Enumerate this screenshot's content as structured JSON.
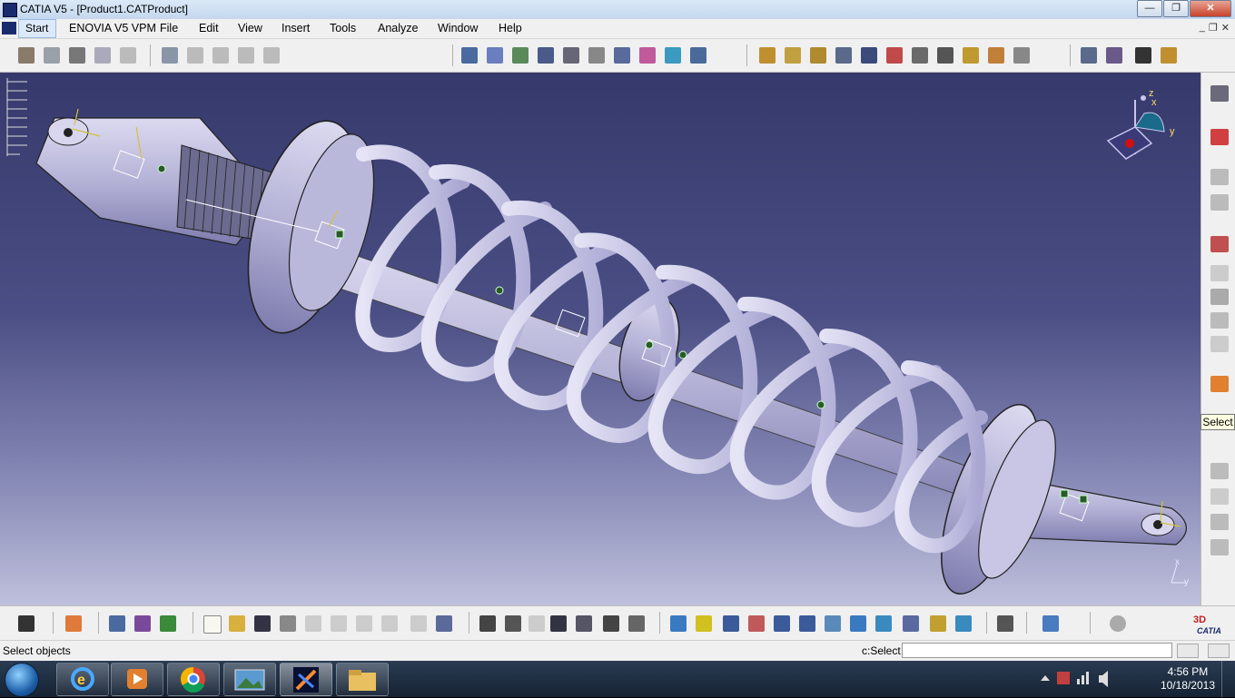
{
  "window": {
    "title": "CATIA V5 - [Product1.CATProduct]"
  },
  "menu": {
    "items": [
      "Start",
      "ENOVIA V5 VPM",
      "File",
      "Edit",
      "View",
      "Insert",
      "Tools",
      "Analyze",
      "Window",
      "Help"
    ]
  },
  "titlebar_buttons": {
    "minimize": "—",
    "maximize": "❐",
    "close": "✕"
  },
  "doc_buttons": {
    "minimize": "_",
    "restore": "❐",
    "close": "✕"
  },
  "compass": {
    "z": "z",
    "x": "x",
    "y": "y"
  },
  "axis_marker": {
    "x": "x",
    "y": "y"
  },
  "right_toolbar": {
    "tooltip": "Select"
  },
  "status": {
    "message": "Select objects",
    "command_label": "c:Select",
    "command_value": ""
  },
  "taskbar": {
    "time": "4:56 PM",
    "date": "10/18/2013"
  },
  "colors": {
    "viewport_top": "#35396b",
    "viewport_bottom": "#bfc0dc",
    "part_fill": "#b9b7d8",
    "spring_fill": "#c6c5e4"
  }
}
